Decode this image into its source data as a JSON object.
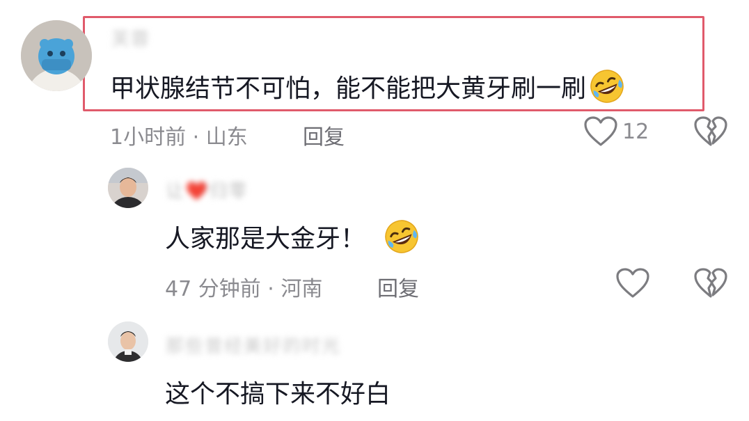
{
  "comments": [
    {
      "username": "芙蓉",
      "text": "甲状腺结节不可怕，能不能把大黄牙刷一刷",
      "emoji": "rofl-emoji",
      "time_location": "1小时前 · 山东",
      "reply_label": "回复",
      "like_count": "12"
    },
    {
      "username": "让❤️归零",
      "text": "人家那是大金牙！",
      "emoji": "rofl-emoji",
      "time_location": "47 分钟前 · 河南",
      "reply_label": "回复",
      "like_count": ""
    },
    {
      "username": "那些曾经美好的时光",
      "text": "这个不搞下来不好白"
    }
  ],
  "colors": {
    "highlight_border": "#e05a6b",
    "meta_text": "#8a8a8f",
    "main_text": "#161823"
  }
}
